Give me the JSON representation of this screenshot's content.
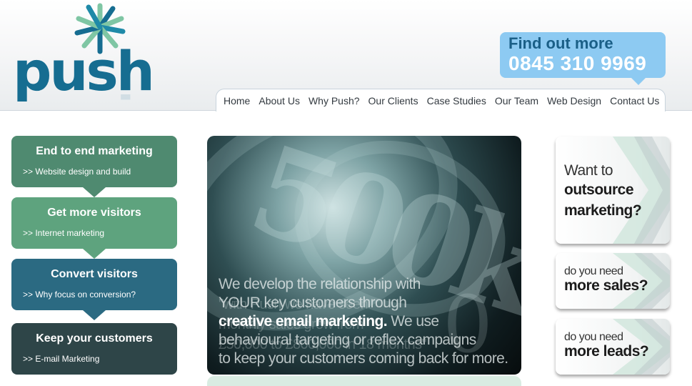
{
  "logo": {
    "word": "push"
  },
  "phone": {
    "label": "Find out more",
    "number": "0845 310 9969"
  },
  "nav": [
    "Home",
    "About Us",
    "Why Push?",
    "Our Clients",
    "Case Studies",
    "Our Team",
    "Web Design",
    "Contact Us"
  ],
  "services": [
    {
      "title": "End to end marketing",
      "link": ">> Website design and build"
    },
    {
      "title": "Get more visitors",
      "link": ">> Internet marketing"
    },
    {
      "title": "Convert visitors",
      "link": ">> Why focus on conversion?"
    },
    {
      "title": "Keep your customers",
      "link": ">> E-mail Marketing"
    }
  ],
  "hero": {
    "line1": "We develop the relationship with",
    "line2": "YOUR key customers through",
    "line3_bold": "creative email marketing.",
    "line3_rest": " We use",
    "line4": "behavioural targeting or reflex campaigns",
    "line5": "to keep your customers coming back for more.",
    "ghost1": "\"with Push we have seen",
    "ghost2": "monthly sales grow from",
    "ghost3": "£50,000 to £800,000 in 18 months\"",
    "numeral": "500k",
    "numeral2": "0"
  },
  "callouts": {
    "outsource": {
      "l1": "Want to",
      "l2": "outsource",
      "l3": "marketing?"
    },
    "sales": {
      "l1": "do you need",
      "l2": "more sales?"
    },
    "leads": {
      "l1": "do you need",
      "l2": "more leads?"
    }
  },
  "colors": {
    "brand": "#166d91",
    "phone_bg": "#8dcaf2",
    "box1": "#4f8a70",
    "box2": "#5ea37e",
    "box3": "#2b6a82",
    "box4": "#2e4548"
  }
}
